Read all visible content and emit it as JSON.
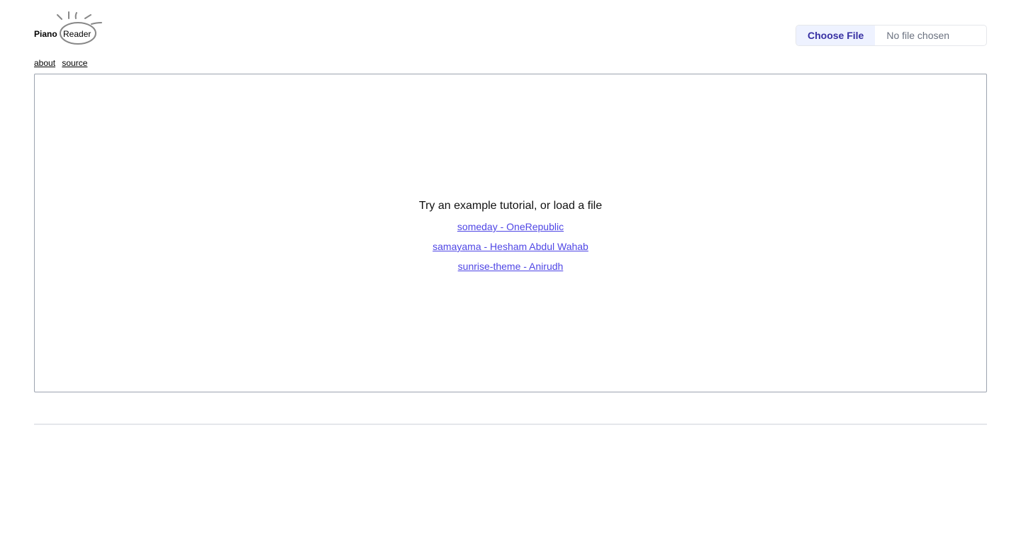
{
  "logo": {
    "piano": "Piano",
    "reader": "Reader"
  },
  "file_input": {
    "button_label": "Choose File",
    "status": "No file chosen"
  },
  "nav": {
    "about": "about",
    "source": "source"
  },
  "main": {
    "prompt": "Try an example tutorial, or load a file",
    "examples": [
      "someday - OneRepublic",
      "samayama - Hesham Abdul Wahab",
      "sunrise-theme - Anirudh"
    ]
  },
  "colors": {
    "accent": "#4f46e5",
    "button_bg": "#eef2ff",
    "button_text": "#3730a3"
  }
}
